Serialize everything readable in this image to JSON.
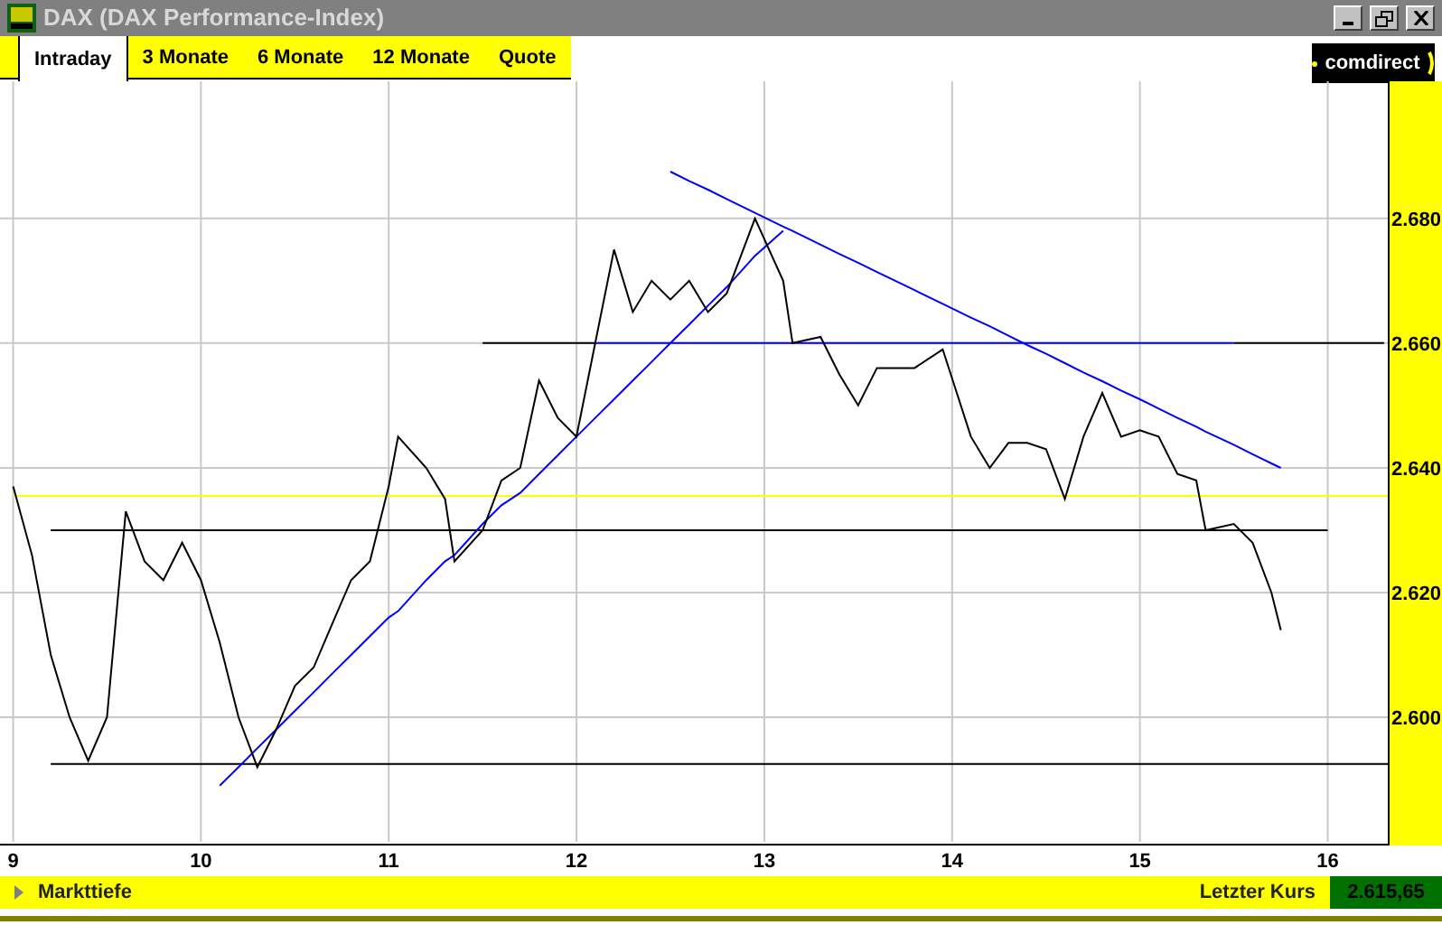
{
  "window": {
    "title": "DAX (DAX Performance-Index)"
  },
  "tabs": [
    {
      "label": "Intraday",
      "selected": true
    },
    {
      "label": "3 Monate",
      "selected": false
    },
    {
      "label": "6 Monate",
      "selected": false
    },
    {
      "label": "12 Monate",
      "selected": false
    },
    {
      "label": "Quote",
      "selected": false
    }
  ],
  "logo": {
    "text": "comdirect"
  },
  "chart": {
    "chart_data": {
      "type": "line",
      "grid": true,
      "xlim": [
        8.93,
        16.32
      ],
      "ylim": [
        2580,
        2702
      ],
      "xticks": [
        9,
        10,
        11,
        12,
        13,
        14,
        15,
        16
      ],
      "yticks": [
        {
          "value": 2600,
          "label": "2.600"
        },
        {
          "value": 2620,
          "label": "2.620"
        },
        {
          "value": 2640,
          "label": "2.640"
        },
        {
          "value": 2660,
          "label": "2.660"
        },
        {
          "value": 2680,
          "label": "2.680"
        }
      ],
      "x": [
        9.0,
        9.1,
        9.2,
        9.3,
        9.4,
        9.5,
        9.6,
        9.7,
        9.8,
        9.9,
        10.0,
        10.1,
        10.2,
        10.3,
        10.4,
        10.5,
        10.6,
        10.7,
        10.8,
        10.9,
        11.0,
        11.05,
        11.2,
        11.3,
        11.35,
        11.5,
        11.6,
        11.7,
        11.8,
        11.9,
        12.0,
        12.1,
        12.2,
        12.3,
        12.4,
        12.5,
        12.6,
        12.7,
        12.8,
        12.95,
        13.1,
        13.15,
        13.3,
        13.4,
        13.5,
        13.6,
        13.8,
        13.95,
        14.1,
        14.2,
        14.3,
        14.4,
        14.5,
        14.6,
        14.7,
        14.8,
        14.9,
        15.0,
        15.1,
        15.2,
        15.3,
        15.35,
        15.5,
        15.6,
        15.7,
        15.75,
        16.0,
        16.3,
        16.32
      ],
      "series": [
        {
          "color": "#ffff00",
          "values": [
            2635.5,
            2635.5,
            2635.5,
            2635.5,
            2635.5,
            2635.5,
            2635.5,
            2635.5,
            2635.5,
            2635.5,
            2635.5,
            2635.5,
            2635.5,
            2635.5,
            2635.5,
            2635.5,
            2635.5,
            2635.5,
            2635.5,
            2635.5,
            2635.5,
            2635.5,
            2635.5,
            2635.5,
            2635.5,
            2635.5,
            2635.5,
            2635.5,
            2635.5,
            2635.5,
            2635.5,
            2635.5,
            2635.5,
            2635.5,
            2635.5,
            2635.5,
            2635.5,
            2635.5,
            2635.5,
            2635.5,
            2635.5,
            2635.5,
            2635.5,
            2635.5,
            2635.5,
            2635.5,
            2635.5,
            2635.5,
            2635.5,
            2635.5,
            2635.5,
            2635.5,
            2635.5,
            2635.5,
            2635.5,
            2635.5,
            2635.5,
            2635.5,
            2635.5,
            2635.5,
            2635.5,
            2635.5,
            2635.5,
            2635.5,
            2635.5,
            2635.5,
            2635.5,
            2635.5,
            2635.5
          ]
        },
        {
          "color": "#000000",
          "values": [
            null,
            null,
            null,
            null,
            null,
            null,
            null,
            null,
            null,
            null,
            null,
            null,
            null,
            null,
            null,
            null,
            null,
            null,
            null,
            null,
            null,
            null,
            null,
            null,
            null,
            2660,
            2660,
            2660,
            2660,
            2660,
            2660,
            2660,
            null,
            null,
            null,
            null,
            null,
            null,
            null,
            null,
            null,
            null,
            null,
            null,
            null,
            null,
            null,
            null,
            null,
            null,
            null,
            null,
            null,
            null,
            null,
            null,
            null,
            null,
            null,
            null,
            null,
            null,
            2660,
            2660,
            2660,
            2660,
            2660,
            2660,
            null
          ]
        },
        {
          "color": "#000000",
          "values": [
            null,
            null,
            2630,
            2630,
            2630,
            2630,
            2630,
            2630,
            2630,
            2630,
            2630,
            2630,
            2630,
            2630,
            2630,
            2630,
            2630,
            2630,
            2630,
            2630,
            2630,
            2630,
            2630,
            2630,
            2630,
            2630,
            2630,
            2630,
            2630,
            2630,
            2630,
            2630,
            2630,
            2630,
            2630,
            2630,
            2630,
            2630,
            2630,
            2630,
            2630,
            2630,
            2630,
            2630,
            2630,
            2630,
            2630,
            2630,
            2630,
            2630,
            2630,
            2630,
            2630,
            2630,
            2630,
            2630,
            2630,
            2630,
            2630,
            2630,
            2630,
            2630,
            2630,
            2630,
            2630,
            2630,
            2630,
            null,
            null
          ]
        },
        {
          "color": "#000000",
          "values": [
            null,
            null,
            2592.5,
            2592.5,
            2592.5,
            2592.5,
            2592.5,
            2592.5,
            2592.5,
            2592.5,
            2592.5,
            2592.5,
            2592.5,
            2592.5,
            2592.5,
            2592.5,
            2592.5,
            2592.5,
            2592.5,
            2592.5,
            2592.5,
            2592.5,
            2592.5,
            2592.5,
            2592.5,
            2592.5,
            2592.5,
            2592.5,
            2592.5,
            2592.5,
            2592.5,
            2592.5,
            2592.5,
            2592.5,
            2592.5,
            2592.5,
            2592.5,
            2592.5,
            2592.5,
            2592.5,
            2592.5,
            2592.5,
            2592.5,
            2592.5,
            2592.5,
            2592.5,
            2592.5,
            2592.5,
            2592.5,
            2592.5,
            2592.5,
            2592.5,
            2592.5,
            2592.5,
            2592.5,
            2592.5,
            2592.5,
            2592.5,
            2592.5,
            2592.5,
            2592.5,
            2592.5,
            2592.5,
            2592.5,
            2592.5,
            2592.5,
            2592.5,
            2592.5,
            2592.5
          ]
        },
        {
          "color": "#0000ff",
          "values": [
            null,
            null,
            null,
            null,
            null,
            null,
            null,
            null,
            null,
            null,
            null,
            null,
            null,
            null,
            null,
            null,
            null,
            null,
            null,
            null,
            null,
            null,
            null,
            null,
            null,
            null,
            null,
            null,
            null,
            null,
            null,
            2660,
            2660,
            2660,
            2660,
            2660,
            2660,
            2660,
            2660,
            2660,
            2660,
            2660,
            2660,
            2660,
            2660,
            2660,
            2660,
            2660,
            2660,
            2660,
            2660,
            2660,
            2660,
            2660,
            2660,
            2660,
            2660,
            2660,
            2660,
            2660,
            2660,
            2660,
            2660,
            null,
            null,
            null,
            null,
            null,
            null
          ]
        },
        {
          "color": "#0000ff",
          "values": [
            null,
            null,
            null,
            null,
            null,
            null,
            null,
            null,
            null,
            null,
            null,
            2589,
            2592,
            2595,
            2598,
            2601,
            2604,
            2607,
            2610,
            2613,
            2616,
            2617,
            2622,
            2625,
            2626,
            2631,
            2634,
            2636,
            2639,
            2642,
            2645,
            2648,
            2651,
            2654,
            2657,
            2660,
            2663,
            2666,
            2669,
            2674,
            2678,
            null,
            null,
            null,
            null,
            null,
            null,
            null,
            null,
            null,
            null,
            null,
            null,
            null,
            null,
            null,
            null,
            null,
            null,
            null,
            null,
            null,
            null,
            null,
            null,
            null,
            null,
            null,
            null
          ]
        },
        {
          "color": "#0000ff",
          "values": [
            null,
            null,
            null,
            null,
            null,
            null,
            null,
            null,
            null,
            null,
            null,
            null,
            null,
            null,
            null,
            null,
            null,
            null,
            null,
            null,
            null,
            null,
            null,
            null,
            null,
            null,
            null,
            null,
            null,
            null,
            null,
            null,
            null,
            null,
            null,
            2687.5,
            2686,
            2684.6,
            2683.1,
            2680.9,
            2678.7,
            2678,
            2675.8,
            2674.3,
            2672.9,
            2671.4,
            2668.5,
            2666.3,
            2664.1,
            2662.7,
            2661.2,
            2659.7,
            2658.3,
            2656.8,
            2655.3,
            2653.9,
            2652.4,
            2651,
            2649.5,
            2648,
            2646.6,
            2645.8,
            2643.7,
            2642.2,
            2640.7,
            2640,
            null,
            null,
            null
          ]
        },
        {
          "color": "#000000",
          "values": [
            2637,
            2626,
            2610,
            2600,
            2593,
            2600,
            2633,
            2625,
            2622,
            2628,
            2622,
            2612,
            2600,
            2592,
            2598,
            2605,
            2608,
            2615,
            2622,
            2625,
            2637,
            2645,
            2640,
            2635,
            2625,
            2630,
            2638,
            2640,
            2654,
            2648,
            2645,
            2660,
            2675,
            2665,
            2670,
            2667,
            2670,
            2665,
            2668,
            2680,
            2670,
            2660,
            2661,
            2655,
            2650,
            2656,
            2656,
            2659,
            2645,
            2640,
            2644,
            2644,
            2643,
            2635,
            2645,
            2652,
            2645,
            2646,
            2645,
            2639,
            2638,
            2630,
            2631,
            2628,
            2620,
            2614,
            null,
            null,
            null
          ]
        }
      ]
    }
  },
  "footer": {
    "depth_label": "Markttiefe",
    "last_label": "Letzter Kurs",
    "last_value": "2.615,65"
  }
}
